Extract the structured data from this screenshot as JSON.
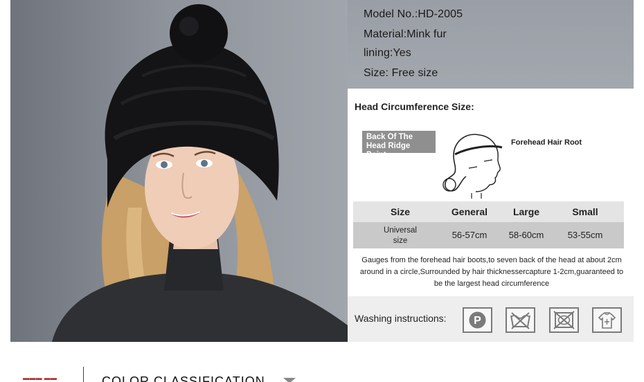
{
  "specs": {
    "model": "Model No.:HD-2005",
    "material": "Material:Mink fur",
    "lining": "lining:Yes",
    "size": "Size: Free size"
  },
  "size_panel": {
    "title": "Head Circumference Size:",
    "ridge_badge": [
      "Back Of The",
      "Head Ridge Point"
    ],
    "forehead_label": "Forehead Hair Root",
    "table": {
      "headers": [
        "Size",
        "General",
        "Large",
        "Small"
      ],
      "row": [
        "Universal size",
        "56-57cm",
        "58-60cm",
        "53-55cm"
      ]
    },
    "note": "Gauges from the forehead hair boots,to seven back of the head at about 2cm around in a circle,Surrounded by hair thicknessercapture 1-2cm,guaranteed to be the largest head circumference"
  },
  "washing": {
    "label": "Washing instructions:",
    "icons": [
      "dry-clean-p-icon",
      "do-not-wash-icon",
      "do-not-tumble-dry-icon",
      "hang-dry-shirt-icon"
    ],
    "p_letter": "P"
  },
  "nav": {
    "section_title": "COLOR CLASSIFICATION"
  },
  "colors": {
    "banner_grey": "#8f939c",
    "hat_black": "#141416",
    "accent_red": "#b03030"
  }
}
